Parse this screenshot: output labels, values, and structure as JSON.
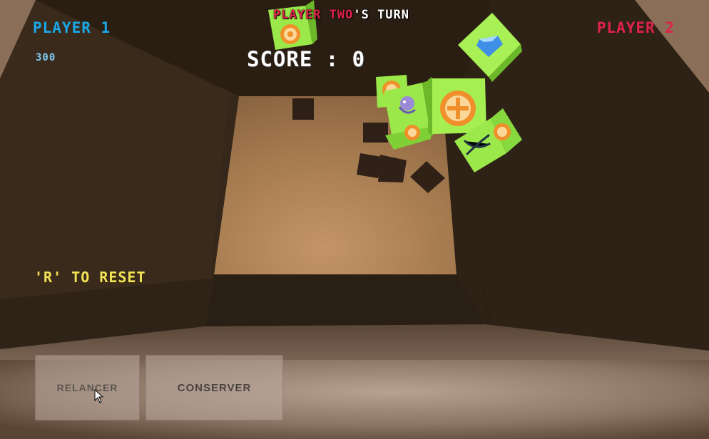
{
  "hud": {
    "player1_label": "PLAYER 1",
    "player1_score": "300",
    "player2_label": "PLAYER 2",
    "turn_player": "PLAYER TWO",
    "turn_suffix": "'S TURN",
    "score_text": "SCORE : 0",
    "reset_hint": "'R' TO RESET"
  },
  "buttons": {
    "reroll_label": "RELANCER",
    "keep_label": "CONSERVER"
  },
  "dice_faces": [
    "coin-icon",
    "diamond-icon",
    "monkey-icon",
    "crossed-swords-icon",
    "parrot-icon"
  ],
  "colors": {
    "player1": "#1aa8e8",
    "player2": "#e0224a",
    "reset_hint": "#f2e25a",
    "die_green": "#9be84a",
    "coin_orange": "#f0902a"
  }
}
